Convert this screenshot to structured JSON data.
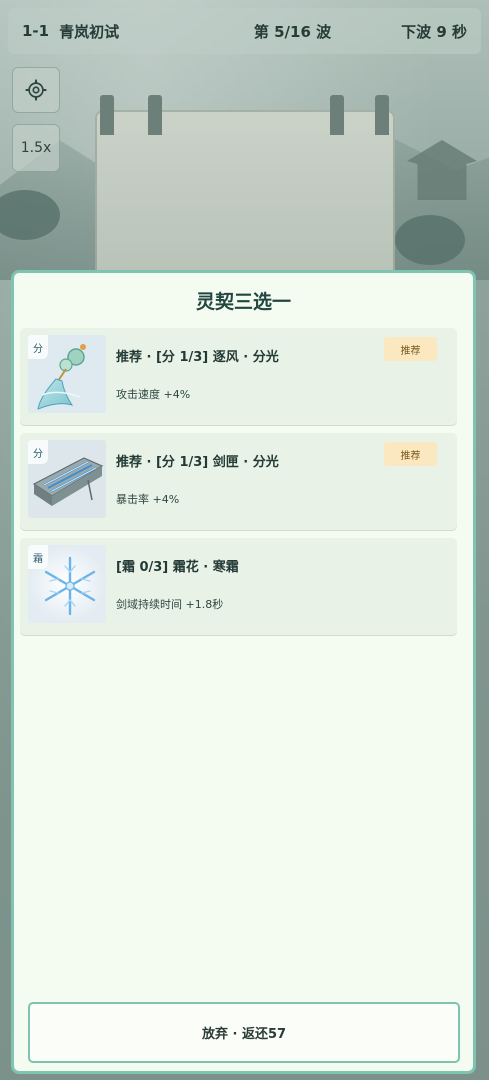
{
  "hud": {
    "level": "1-1",
    "stage_name": "青岚初试",
    "wave": "第 5/16 波",
    "next_wave": "下波 9 秒",
    "speed": "1.5x",
    "settings_icon": "gear-icon"
  },
  "panel": {
    "title": "灵契三选一",
    "cards": [
      {
        "tag": "分",
        "name": "推荐 · [分 1/3] 逐风 · 分光",
        "desc": "攻击速度 +4%",
        "badge": "推荐",
        "icon": "jade-tassel-icon"
      },
      {
        "tag": "分",
        "name": "推荐 · [分 1/3] 剑匣 · 分光",
        "desc": "暴击率 +4%",
        "badge": "推荐",
        "icon": "sword-case-icon"
      },
      {
        "tag": "霜",
        "name": "[霜 0/3] 霜花 · 寒霜",
        "desc": "剑域持续时间 +1.8秒",
        "badge": "",
        "icon": "snowflake-icon"
      }
    ],
    "abandon_label": "放弃 · 返还57"
  }
}
